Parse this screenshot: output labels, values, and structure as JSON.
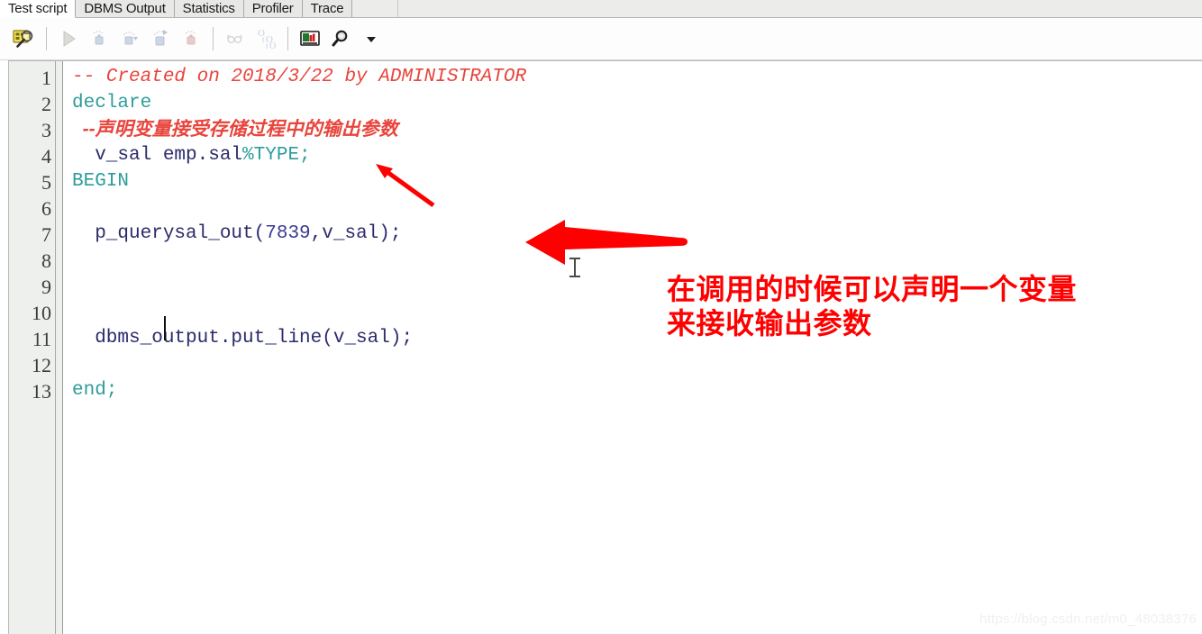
{
  "tabs": [
    {
      "label": "Test script",
      "active": true
    },
    {
      "label": "DBMS Output",
      "active": false
    },
    {
      "label": "Statistics",
      "active": false
    },
    {
      "label": "Profiler",
      "active": false
    },
    {
      "label": "Trace",
      "active": false
    }
  ],
  "toolbar": {
    "buttons": [
      {
        "name": "test-window-icon",
        "enabled": true
      },
      {
        "name": "run-icon",
        "enabled": false
      },
      {
        "name": "step-into-icon",
        "enabled": false
      },
      {
        "name": "step-over-icon",
        "enabled": false
      },
      {
        "name": "step-out-icon",
        "enabled": false
      },
      {
        "name": "run-to-exception-icon",
        "enabled": false
      },
      {
        "name": "breakpoints-icon",
        "enabled": false
      },
      {
        "name": "variables-icon",
        "enabled": false
      },
      {
        "name": "output-window-icon",
        "enabled": true
      },
      {
        "name": "search-icon",
        "enabled": true
      },
      {
        "name": "chevron-down-icon",
        "enabled": true
      }
    ]
  },
  "editor": {
    "line_numbers": [
      "1",
      "2",
      "3",
      "4",
      "5",
      "6",
      "7",
      "8",
      "9",
      "10",
      "11",
      "12",
      "13"
    ],
    "caret_line": 8,
    "lines": [
      {
        "n": 1,
        "tokens": [
          {
            "text": "-- Created on 2018/3/22 by ADMINISTRATOR",
            "cls": "c-comment"
          }
        ]
      },
      {
        "n": 2,
        "tokens": [
          {
            "text": "declare",
            "cls": "c-key"
          }
        ]
      },
      {
        "n": 3,
        "tokens": [
          {
            "text": "  --声明变量接受存储过程中的输出参数",
            "cls": "c-comment-cjk"
          }
        ]
      },
      {
        "n": 4,
        "tokens": [
          {
            "text": "  v_sal emp.sal",
            "cls": "c-plain"
          },
          {
            "text": "%TYPE;",
            "cls": "c-key"
          }
        ]
      },
      {
        "n": 5,
        "tokens": [
          {
            "text": "BEGIN",
            "cls": "c-key"
          }
        ]
      },
      {
        "n": 6,
        "tokens": [
          {
            "text": "",
            "cls": "c-plain"
          }
        ]
      },
      {
        "n": 7,
        "tokens": [
          {
            "text": "  p_querysal_out(",
            "cls": "c-plain"
          },
          {
            "text": "7839",
            "cls": "c-num"
          },
          {
            "text": ",v_sal);",
            "cls": "c-plain"
          }
        ]
      },
      {
        "n": 8,
        "tokens": [
          {
            "text": "",
            "cls": "c-plain"
          }
        ]
      },
      {
        "n": 9,
        "tokens": [
          {
            "text": "",
            "cls": "c-plain"
          }
        ]
      },
      {
        "n": 10,
        "tokens": [
          {
            "text": "",
            "cls": "c-plain"
          }
        ]
      },
      {
        "n": 11,
        "tokens": [
          {
            "text": "  dbms_output.put_line(v_sal);",
            "cls": "c-plain"
          }
        ]
      },
      {
        "n": 12,
        "tokens": [
          {
            "text": "",
            "cls": "c-plain"
          }
        ]
      },
      {
        "n": 13,
        "tokens": [
          {
            "text": "end;",
            "cls": "c-key"
          }
        ]
      }
    ]
  },
  "annotation": {
    "text_line1": "在调用的时候可以声明一个变量",
    "text_line2": "来接收输出参数",
    "color": "#fe0000",
    "arrows": [
      {
        "name": "thin-arrow",
        "direction": "up-left"
      },
      {
        "name": "thick-arrow",
        "direction": "left"
      }
    ]
  },
  "watermark": {
    "text": "https://blog.csdn.net/m0_48038376"
  },
  "colors": {
    "comment": "#e8453c",
    "keyword": "#2e9c9c",
    "identifier": "#3b3b8f",
    "annotation_red": "#fe0000",
    "gutter_bg": "#eef0ee",
    "toolbar_bg": "#fdfdfd",
    "tab_active_bg": "#ffffff",
    "tab_inactive_bg": "#e8e8e6"
  }
}
